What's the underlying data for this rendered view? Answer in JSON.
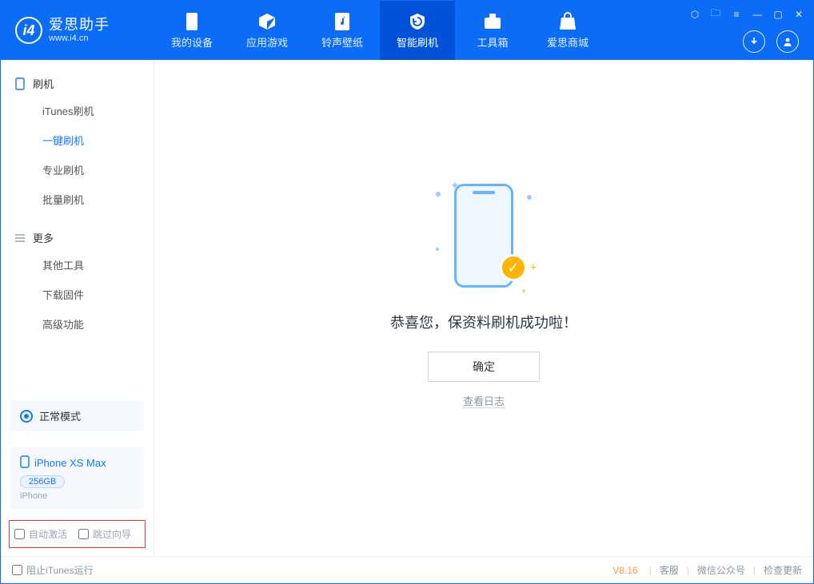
{
  "brand": {
    "title": "爱思助手",
    "subtitle": "www.i4.cn"
  },
  "tabs": [
    {
      "id": "device",
      "label": "我的设备"
    },
    {
      "id": "apps",
      "label": "应用游戏"
    },
    {
      "id": "ring",
      "label": "铃声壁纸"
    },
    {
      "id": "flash",
      "label": "智能刷机"
    },
    {
      "id": "toolbox",
      "label": "工具箱"
    },
    {
      "id": "store",
      "label": "爱思商城"
    }
  ],
  "sidebar": {
    "group1": {
      "title": "刷机"
    },
    "flash_items": [
      {
        "label": "iTunes刷机"
      },
      {
        "label": "一键刷机"
      },
      {
        "label": "专业刷机"
      },
      {
        "label": "批量刷机"
      }
    ],
    "group2": {
      "title": "更多"
    },
    "more_items": [
      {
        "label": "其他工具"
      },
      {
        "label": "下载固件"
      },
      {
        "label": "高级功能"
      }
    ]
  },
  "mode": {
    "label": "正常模式"
  },
  "device": {
    "name": "iPhone XS Max",
    "capacity": "256GB",
    "type": "iPhone"
  },
  "options": {
    "auto_activate": "自动激活",
    "skip_guide": "跳过向导"
  },
  "main": {
    "success_title": "恭喜您，保资料刷机成功啦！",
    "ok": "确定",
    "view_log": "查看日志"
  },
  "footer": {
    "block_itunes": "阻止iTunes运行",
    "version": "V8.16",
    "support": "客服",
    "wechat": "微信公众号",
    "update": "检查更新"
  }
}
